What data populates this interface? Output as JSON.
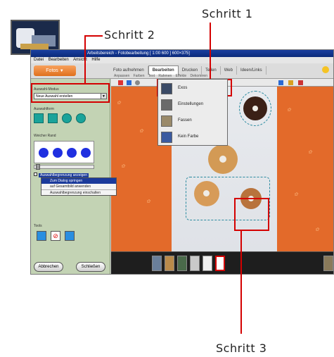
{
  "callouts": {
    "step1": "Schritt 1",
    "step2": "Schritt 2",
    "step3": "Schritt 3"
  },
  "app": {
    "title": "Arbeitsbereich - Fotobearbeitung [ 1:00 600 ] 600×375]",
    "menu": [
      "Datei",
      "Bearbeiten",
      "Ansicht",
      "Hilfe"
    ],
    "fotos_button": "Fotos",
    "tabs": [
      "Foto aufnehmen",
      "Bearbeiten",
      "Drucken",
      "Teilen",
      "Web",
      "Ideen/Links"
    ],
    "active_tab": "Bearbeiten",
    "subtabs": [
      "Anpassen",
      "Farben",
      "Text",
      "Rahmen",
      "Effekte",
      "Dekorieren"
    ]
  },
  "left_panel": {
    "mode_label": "Auswahl-Modus",
    "mode_value": "Neue Auswahl erstellen",
    "shapes_label": "Auswahlform",
    "edge_label": "Weicher Rand",
    "context_checkbox": "Auswahlbegrenzung anzeigen",
    "context_menu": [
      "Zum Dialog springen",
      "auf Gesamtbild anwenden",
      "Auswahlbegrenzung einschalten"
    ],
    "tools_label": "Tools",
    "cancel_button": "Abbrechen",
    "close_button": "Schließen"
  },
  "dropdown": {
    "items": [
      "Exos",
      "Einstellungen",
      "Fassen",
      "Kein Farbe"
    ]
  },
  "colors": {
    "accent_red": "#d40000",
    "work_orange": "#e36a2a",
    "panel_green": "#c3d3b4",
    "brush_blue": "#1f2fe0"
  }
}
